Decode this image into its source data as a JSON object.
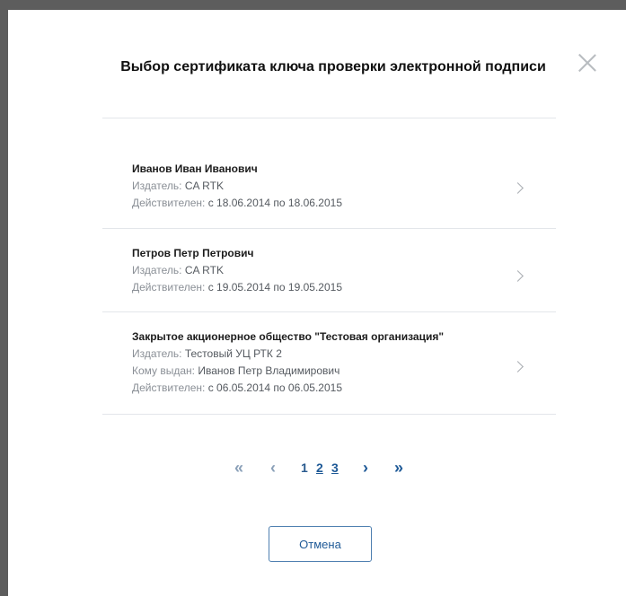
{
  "dialog": {
    "title": "Выбор сертификата ключа проверки электронной подписи"
  },
  "certificates": [
    {
      "name": "Иванов Иван Иванович",
      "issuer_label": "Издатель:",
      "issuer": "CA RTK",
      "valid_label": "Действителен:",
      "valid": "с 18.06.2014 по 18.06.2015"
    },
    {
      "name": "Петров Петр Петрович",
      "issuer_label": "Издатель:",
      "issuer": "CA RTK",
      "valid_label": "Действителен:",
      "valid": "с 19.05.2014 по 19.05.2015"
    },
    {
      "name": "Закрытое акционерное общество \"Тестовая организация\"",
      "issuer_label": "Издатель:",
      "issuer": "Тестовый УЦ РТК 2",
      "issued_to_label": "Кому выдан:",
      "issued_to": "Иванов Петр Владимирович",
      "valid_label": "Действителен:",
      "valid": "с 06.05.2014 по 06.05.2015"
    }
  ],
  "pagination": {
    "first": "«",
    "prev": "‹",
    "pages": [
      "1",
      "2",
      "3"
    ],
    "current": "1",
    "next": "›",
    "last": "»"
  },
  "buttons": {
    "cancel": "Отмена"
  },
  "colors": {
    "backdrop": "#5d5d5d",
    "accent": "#1f5a97",
    "divider": "#e3e6ea"
  },
  "icons": {
    "close": "close-icon",
    "chevron": "chevron-right-icon"
  }
}
